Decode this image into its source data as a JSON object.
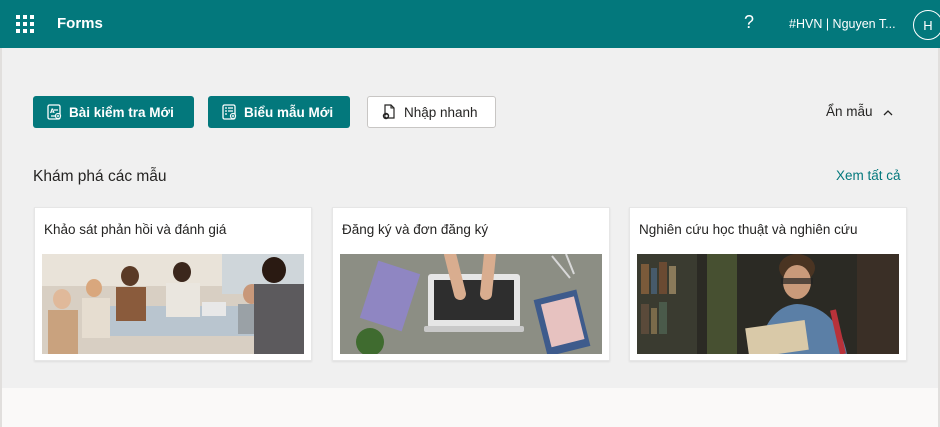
{
  "header": {
    "app_name": "Forms",
    "help_symbol": "?",
    "account": "#HVN | Nguyen T...",
    "avatar_initial": "H"
  },
  "toolbar": {
    "new_quiz": "Bài kiểm tra Mới",
    "new_form": "Biểu mẫu Mới",
    "quick_import": "Nhập nhanh"
  },
  "templates": {
    "toggle_label": "Ẩn mẫu",
    "section_title": "Khám phá các mẫu",
    "see_all": "Xem tất cả",
    "cards": [
      {
        "title": "Khảo sát phản hồi và đánh giá",
        "image": "people-meeting-photo"
      },
      {
        "title": "Đăng ký và đơn đăng ký",
        "image": "laptop-notebooks-photo"
      },
      {
        "title": "Nghiên cứu học thuật và nghiên cứu",
        "image": "student-reading-library-photo"
      }
    ]
  },
  "colors": {
    "brand": "#03787c",
    "background": "#f0f0f0"
  }
}
